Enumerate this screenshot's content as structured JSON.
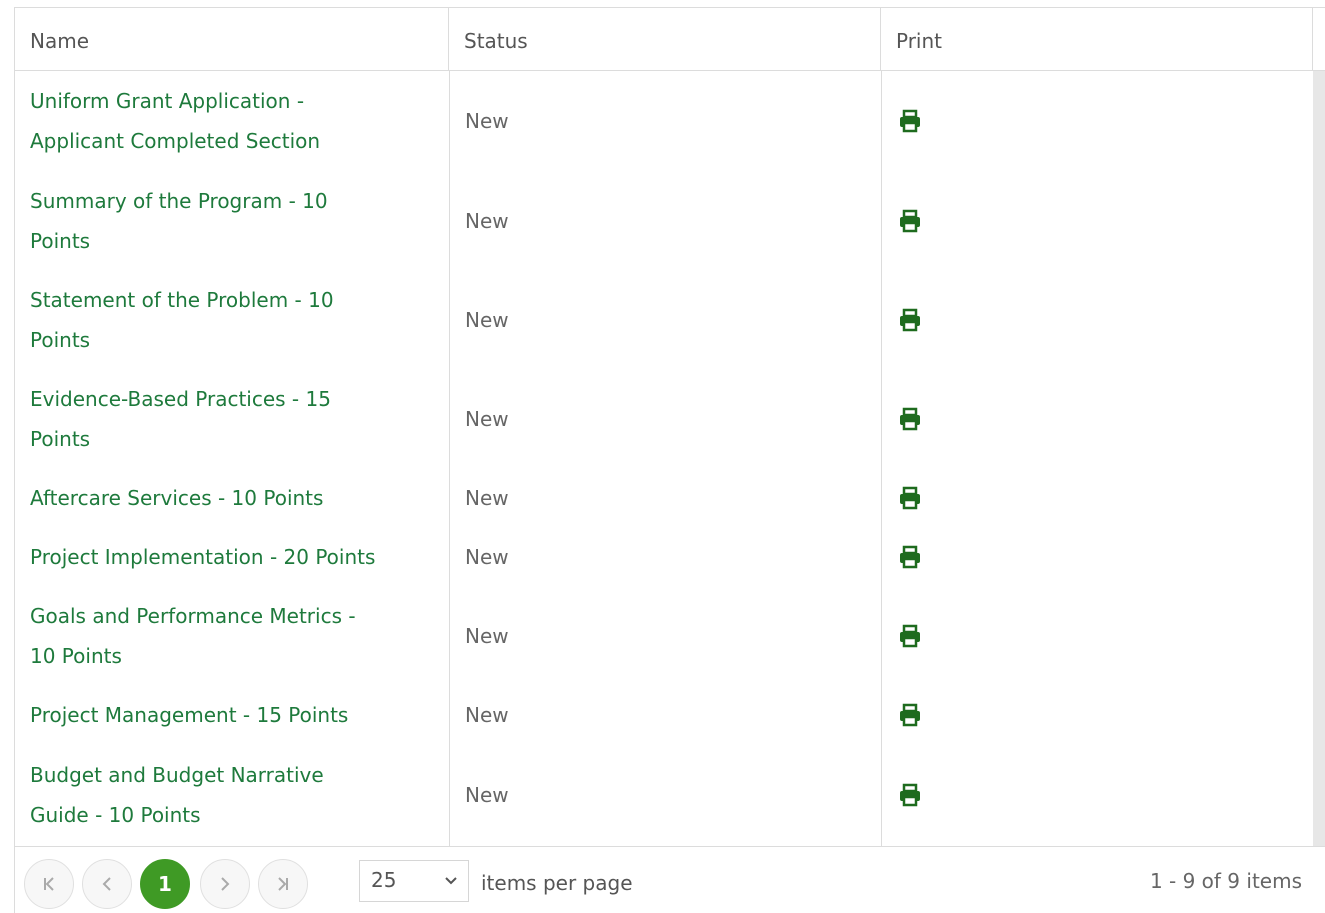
{
  "columns": {
    "name": "Name",
    "status": "Status",
    "print": "Print"
  },
  "rows": [
    {
      "name_lines": [
        "Uniform Grant Application -",
        "Applicant Completed Section"
      ],
      "status": "New",
      "print_icon": "printer-icon"
    },
    {
      "name_lines": [
        "Summary of the Program - 10",
        "Points"
      ],
      "status": "New",
      "print_icon": "printer-icon"
    },
    {
      "name_lines": [
        "Statement of the Problem - 10",
        "Points"
      ],
      "status": "New",
      "print_icon": "printer-icon"
    },
    {
      "name_lines": [
        "Evidence-Based Practices - 15",
        "Points"
      ],
      "status": "New",
      "print_icon": "printer-icon"
    },
    {
      "name_lines": [
        "Aftercare Services - 10 Points"
      ],
      "status": "New",
      "print_icon": "printer-icon"
    },
    {
      "name_lines": [
        "Project Implementation - 20 Points"
      ],
      "status": "New",
      "print_icon": "printer-icon"
    },
    {
      "name_lines": [
        "Goals and Performance Metrics -",
        "10 Points"
      ],
      "status": "New",
      "print_icon": "printer-icon"
    },
    {
      "name_lines": [
        "Project Management - 15 Points"
      ],
      "status": "New",
      "print_icon": "printer-icon"
    },
    {
      "name_lines": [
        "Budget and Budget Narrative",
        "Guide - 10 Points"
      ],
      "status": "New",
      "print_icon": "printer-icon"
    }
  ],
  "pager": {
    "first_icon": "first-page-icon",
    "prev_icon": "previous-page-icon",
    "current_page": "1",
    "next_icon": "next-page-icon",
    "last_icon": "last-page-icon",
    "page_size": "25",
    "page_size_label": "items per page",
    "info": "1 - 9 of 9 items"
  },
  "colors": {
    "link": "#1e7a3c",
    "icon": "#1e6b1e",
    "active_page": "#3f9a25",
    "border": "#dcdcdc",
    "scrollbar": "#e7e7e7"
  }
}
